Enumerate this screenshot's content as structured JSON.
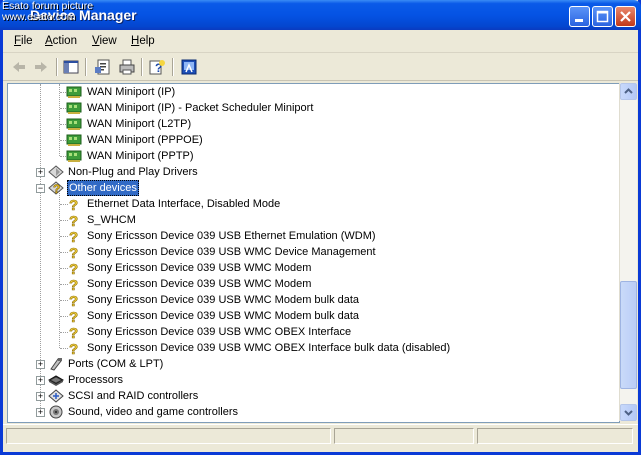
{
  "window": {
    "title": "Device Manager",
    "watermark_line1": "Esato forum picture",
    "watermark_line2": "www.esato.com"
  },
  "menu": [
    "File",
    "Action",
    "View",
    "Help"
  ],
  "toolbar_icons": [
    "back-arrow-icon",
    "forward-arrow-icon",
    "show-hide-console-tree-icon",
    "properties-icon",
    "print-icon",
    "help-icon",
    "update-driver-icon"
  ],
  "tree": {
    "wan_items": [
      "WAN Miniport (IP)",
      "WAN Miniport (IP) - Packet Scheduler Miniport",
      "WAN Miniport (L2TP)",
      "WAN Miniport (PPPOE)",
      "WAN Miniport (PPTP)"
    ],
    "non_plug": "Non-Plug and Play Drivers",
    "other_devices": "Other devices",
    "other_items": [
      "Ethernet Data Interface, Disabled Mode",
      "S_WHCM",
      "Sony Ericsson Device 039 USB Ethernet Emulation (WDM)",
      "Sony Ericsson Device 039 USB WMC Device Management",
      "Sony Ericsson Device 039 USB WMC Modem",
      "Sony Ericsson Device 039 USB WMC Modem",
      "Sony Ericsson Device 039 USB WMC Modem bulk data",
      "Sony Ericsson Device 039 USB WMC Modem bulk data",
      "Sony Ericsson Device 039 USB WMC OBEX Interface",
      "Sony Ericsson Device 039 USB WMC OBEX Interface bulk data (disabled)"
    ],
    "bottom_categories": [
      "Ports (COM & LPT)",
      "Processors",
      "SCSI and RAID controllers",
      "Sound, video and game controllers"
    ]
  },
  "colors": {
    "selection": "#316ac5",
    "titlebar": "#0553e4",
    "warning": "#f5d640"
  }
}
